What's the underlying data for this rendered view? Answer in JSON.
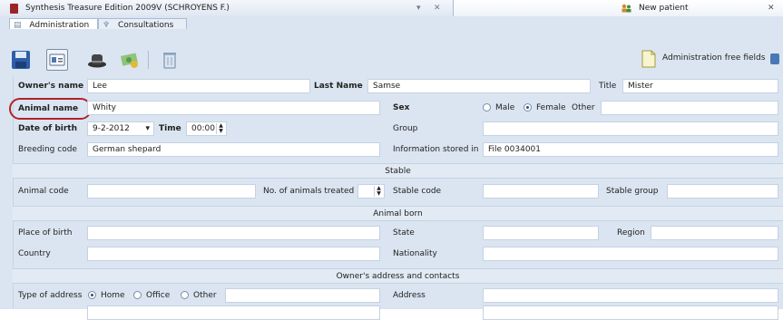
{
  "tabs": {
    "main_title": "Synthesis Treasure Edition 2009V (SCHROYENS F.)",
    "new_patient": "New patient"
  },
  "subtabs": [
    "Administration",
    "Consultations"
  ],
  "toolbar": {
    "free_fields": "Administration free fields"
  },
  "owner": {
    "label": "Owner's name",
    "value": "Lee",
    "last_label": "Last Name",
    "last_value": "Samse",
    "title_label": "Title",
    "title_value": "Mister"
  },
  "animal": {
    "name_label": "Animal name",
    "name_value": "Whity",
    "sex_label": "Sex",
    "sex_options": [
      "Male",
      "Female",
      "Other"
    ],
    "sex_selected": "Female",
    "dob_label": "Date of birth",
    "dob_value": "9-2-2012",
    "time_label": "Time",
    "time_value": "00:00",
    "group_label": "Group",
    "breed_label": "Breeding code",
    "breed_value": "German shepard",
    "info_label": "Information stored in",
    "info_value": "File 0034001"
  },
  "stable": {
    "section": "Stable",
    "animal_code": "Animal code",
    "treated": "No. of animals treated",
    "stable_code": "Stable code",
    "stable_group": "Stable group"
  },
  "born": {
    "section": "Animal born",
    "place": "Place of birth",
    "state": "State",
    "region": "Region",
    "country": "Country",
    "nationality": "Nationality"
  },
  "address": {
    "section": "Owner's address and contacts",
    "type_label": "Type of address",
    "type_options": [
      "Home",
      "Office",
      "Other"
    ],
    "type_selected": "Home",
    "address_label": "Address"
  },
  "colors": {
    "highlight": "#b3212b",
    "panel": "#dbe5f1"
  }
}
